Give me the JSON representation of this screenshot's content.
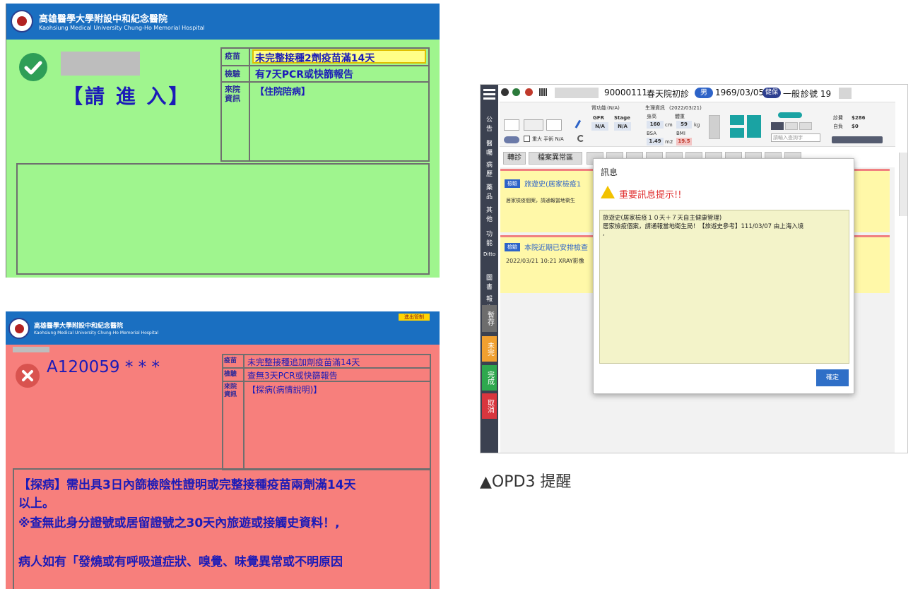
{
  "green_panel": {
    "hospital_name": "高雄醫學大學附設中和紀念醫院",
    "hospital_eng": "Kaohsiung Medical University Chung-Ho Memorial Hospital",
    "status_text": "【請 進 入】",
    "rows": [
      {
        "label": "疫苗",
        "value": "未完整接種2劑疫苗滿14天"
      },
      {
        "label": "檢驗",
        "value": "有7天PCR或快篩報告"
      },
      {
        "label": "來院資訊",
        "value": "【住院陪病】"
      }
    ],
    "colors": {
      "bg": "#9ff58e",
      "accent": "#1a6fc1",
      "icon": "#2e9e57"
    },
    "icon": "check-circle-icon"
  },
  "red_panel": {
    "hospital_name": "高雄醫學大學附設中和紀念醫院",
    "hospital_eng": "Kaohsiung Medical University Chung-Ho Memorial Hospital",
    "badge": "進出管制",
    "patient_id": "A120059 * * *",
    "rows": [
      {
        "label": "疫苗",
        "value": "未完整接種追加劑疫苗滿14天"
      },
      {
        "label": "檢驗",
        "value": "查無3天PCR或快篩報告"
      },
      {
        "label": "來院資訊",
        "value": "【探病(病情說明)】"
      }
    ],
    "message_lines": [
      "【探病】需出具3日內篩檢陰性證明或完整接種疫苗兩劑滿14天",
      "以上。",
      "※查無此身分證號或居留證號之30天內旅遊或接觸史資料！,",
      "",
      "病人如有「發燒或有呼吸道症狀、嗅覺、味覺異常或不明原因"
    ],
    "colors": {
      "bg": "#f77f7c",
      "icon": "#d9534f"
    },
    "icon": "x-circle-icon"
  },
  "opd": {
    "header": {
      "chart_no": "90000111",
      "visit": "春天院初診",
      "sex": "男",
      "birth": "1969/03/05",
      "category_badge": "健保",
      "category": "一般",
      "clinic_no": "診號 19"
    },
    "info": {
      "kidney_label": "腎功能",
      "kidney_val": "(N/A)",
      "gfr": "GFR",
      "stage": "Stage",
      "gfr_val": "N/A",
      "stage_val": "N/A",
      "vital_label": "生理資訊",
      "vital_date": "(2022/03/21)",
      "height_lbl": "身高",
      "weight_lbl": "體重",
      "height": "160",
      "height_unit": "cm",
      "weight": "59",
      "weight_unit": "kg",
      "bsa_lbl": "BSA",
      "bmi_lbl": "BMI",
      "bsa": "1.49",
      "bsa_unit": "m2",
      "bmi": "19.5",
      "checkbox_label": "重大 手術 N/A",
      "search_placeholder": "請輸入查詢字",
      "total_label": "診費",
      "total": "$286",
      "self_label": "自負",
      "self": "$0"
    },
    "tabs": [
      "轉診",
      "檔案異常區"
    ],
    "sidebar": [
      "公告",
      "醫囑",
      "病歷",
      "藥品",
      "其他",
      "功能",
      "Ditto",
      "圖書",
      "報告"
    ],
    "side_buttons": [
      {
        "label": "暫存",
        "color": "#6d6d6d"
      },
      {
        "label": "未完",
        "color": "#f0a030"
      },
      {
        "label": "完成",
        "color": "#2ea84e"
      },
      {
        "label": "取消",
        "color": "#d9363e"
      }
    ],
    "notice1_tag": "檢驗",
    "notice1_title": "旅遊史(居家檢疫1",
    "notice1_text": "居家檢疫個案，請通報當地衛生",
    "notice2_tag": "檢驗",
    "notice2_title": "本院近期已安排檢查",
    "notice2_text": "2022/03/21 10:21 XRAY影像",
    "dialog": {
      "title": "訊息",
      "warning": "重要訊息提示!!",
      "line1": "旅遊史(居家檢疫１０天＋７天自主健康管理)",
      "line2": "居家檢疫個案，請通報當地衛生局！【旅遊史參考】111/03/07 由上海入境",
      "line3": ",",
      "confirm": "確定"
    }
  },
  "caption": "▲OPD3 提醒"
}
